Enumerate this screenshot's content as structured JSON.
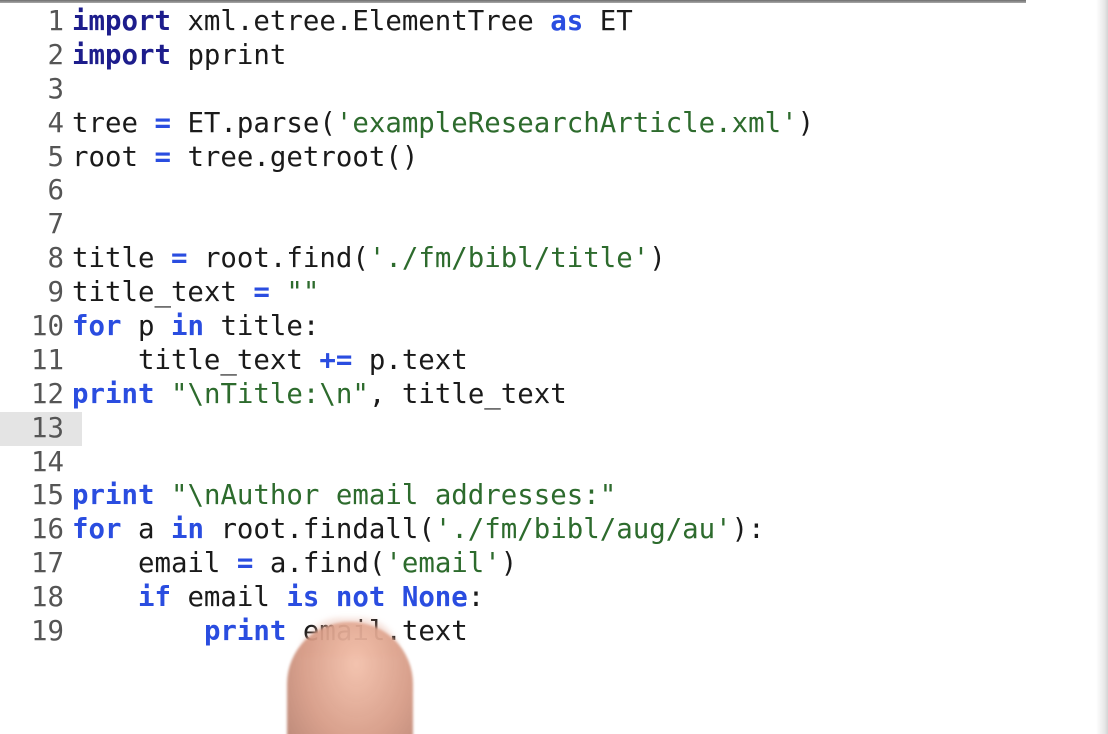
{
  "colors": {
    "keyword": "#1d1d8c",
    "operator": "#2a4de0",
    "string": "#2d6b2d",
    "line_number": "#555555",
    "current_line_gutter": "#e4e4e4",
    "background": "#ffffff"
  },
  "editor": {
    "current_line": 13,
    "lines": [
      {
        "number": "1",
        "tokens": [
          {
            "t": "import",
            "k": "keyword"
          },
          {
            "t": " xml.etree.ElementTree ",
            "k": "default"
          },
          {
            "t": "as",
            "k": "operator"
          },
          {
            "t": " ET",
            "k": "default"
          }
        ]
      },
      {
        "number": "2",
        "tokens": [
          {
            "t": "import",
            "k": "keyword"
          },
          {
            "t": " pprint",
            "k": "default"
          }
        ]
      },
      {
        "number": "3",
        "tokens": []
      },
      {
        "number": "4",
        "tokens": [
          {
            "t": "tree ",
            "k": "default"
          },
          {
            "t": "=",
            "k": "operator"
          },
          {
            "t": " ET.parse(",
            "k": "default"
          },
          {
            "t": "'exampleResearchArticle.xml'",
            "k": "string"
          },
          {
            "t": ")",
            "k": "default"
          }
        ]
      },
      {
        "number": "5",
        "tokens": [
          {
            "t": "root ",
            "k": "default"
          },
          {
            "t": "=",
            "k": "operator"
          },
          {
            "t": " tree.getroot()",
            "k": "default"
          }
        ]
      },
      {
        "number": "6",
        "tokens": []
      },
      {
        "number": "7",
        "tokens": []
      },
      {
        "number": "8",
        "tokens": [
          {
            "t": "title ",
            "k": "default"
          },
          {
            "t": "=",
            "k": "operator"
          },
          {
            "t": " root.find(",
            "k": "default"
          },
          {
            "t": "'./fm/bibl/title'",
            "k": "string"
          },
          {
            "t": ")",
            "k": "default"
          }
        ]
      },
      {
        "number": "9",
        "tokens": [
          {
            "t": "title_text ",
            "k": "default"
          },
          {
            "t": "=",
            "k": "operator"
          },
          {
            "t": " ",
            "k": "default"
          },
          {
            "t": "\"\"",
            "k": "string"
          }
        ]
      },
      {
        "number": "10",
        "tokens": [
          {
            "t": "for",
            "k": "operator"
          },
          {
            "t": " p ",
            "k": "default"
          },
          {
            "t": "in",
            "k": "operator"
          },
          {
            "t": " title:",
            "k": "default"
          }
        ]
      },
      {
        "number": "11",
        "tokens": [
          {
            "t": "    title_text ",
            "k": "default"
          },
          {
            "t": "+=",
            "k": "operator"
          },
          {
            "t": " p.text",
            "k": "default"
          }
        ]
      },
      {
        "number": "12",
        "tokens": [
          {
            "t": "print",
            "k": "operator"
          },
          {
            "t": " ",
            "k": "default"
          },
          {
            "t": "\"",
            "k": "string"
          },
          {
            "t": "\\n",
            "k": "escape"
          },
          {
            "t": "Title:",
            "k": "string"
          },
          {
            "t": "\\n",
            "k": "escape"
          },
          {
            "t": "\"",
            "k": "string"
          },
          {
            "t": ", title_text",
            "k": "default"
          }
        ]
      },
      {
        "number": "13",
        "tokens": []
      },
      {
        "number": "14",
        "tokens": []
      },
      {
        "number": "15",
        "tokens": [
          {
            "t": "print",
            "k": "operator"
          },
          {
            "t": " ",
            "k": "default"
          },
          {
            "t": "\"",
            "k": "string"
          },
          {
            "t": "\\n",
            "k": "escape"
          },
          {
            "t": "Author email addresses:\"",
            "k": "string"
          }
        ]
      },
      {
        "number": "16",
        "tokens": [
          {
            "t": "for",
            "k": "operator"
          },
          {
            "t": " a ",
            "k": "default"
          },
          {
            "t": "in",
            "k": "operator"
          },
          {
            "t": " root.findall(",
            "k": "default"
          },
          {
            "t": "'./fm/bibl/aug/au'",
            "k": "string"
          },
          {
            "t": "):",
            "k": "default"
          }
        ]
      },
      {
        "number": "17",
        "tokens": [
          {
            "t": "    email ",
            "k": "default"
          },
          {
            "t": "=",
            "k": "operator"
          },
          {
            "t": " a.find(",
            "k": "default"
          },
          {
            "t": "'email'",
            "k": "string"
          },
          {
            "t": ")",
            "k": "default"
          }
        ]
      },
      {
        "number": "18",
        "tokens": [
          {
            "t": "    ",
            "k": "default"
          },
          {
            "t": "if",
            "k": "operator"
          },
          {
            "t": " email ",
            "k": "default"
          },
          {
            "t": "is not None",
            "k": "operator"
          },
          {
            "t": ":",
            "k": "default"
          }
        ]
      },
      {
        "number": "19",
        "tokens": [
          {
            "t": "        ",
            "k": "default"
          },
          {
            "t": "print",
            "k": "operator"
          },
          {
            "t": " email.text",
            "k": "default"
          }
        ]
      }
    ]
  }
}
